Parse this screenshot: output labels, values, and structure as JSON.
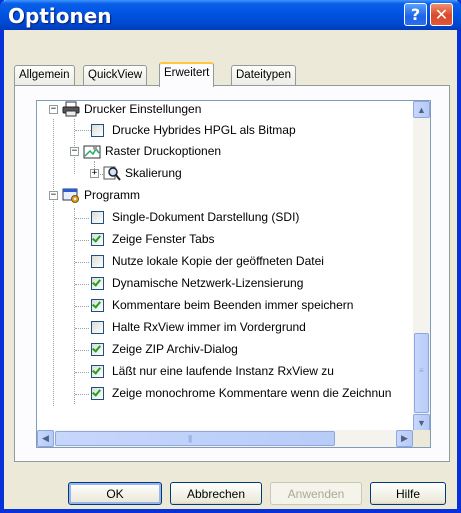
{
  "window": {
    "title": "Optionen",
    "help_glyph": "?",
    "close_glyph": "✕"
  },
  "tabs": [
    {
      "label": "Allgemein"
    },
    {
      "label": "QuickView"
    },
    {
      "label": "Erweitert",
      "selected": true
    },
    {
      "label": "Dateitypen"
    }
  ],
  "tree": {
    "printer_group": {
      "label": "Drucker Einstellungen",
      "icon": "printer-icon",
      "expanded": true
    },
    "hpgl": {
      "label": "Drucke Hybrides HPGL als Bitmap",
      "checked": false
    },
    "raster_group": {
      "label": "Raster Druckoptionen",
      "icon": "raster-icon",
      "expanded": true
    },
    "scaling": {
      "label": "Skalierung",
      "icon": "magnifier-icon",
      "expanded": false
    },
    "program_group": {
      "label": "Programm",
      "icon": "program-icon",
      "expanded": true
    },
    "options": [
      {
        "label": "Single-Dokument Darstellung (SDI)",
        "checked": false
      },
      {
        "label": "Zeige Fenster Tabs",
        "checked": true
      },
      {
        "label": "Nutze lokale Kopie der geöffneten Datei",
        "checked": false
      },
      {
        "label": "Dynamische Netzwerk-Lizensierung",
        "checked": true
      },
      {
        "label": "Kommentare beim Beenden immer speichern",
        "checked": true
      },
      {
        "label": "Halte RxView immer im Vordergrund",
        "checked": false
      },
      {
        "label": "Zeige ZIP Archiv-Dialog",
        "checked": true
      },
      {
        "label": "Läßt nur eine laufende Instanz RxView zu",
        "checked": true
      },
      {
        "label": "Zeige monochrome Kommentare wenn die Zeichnun",
        "checked": true
      }
    ]
  },
  "scrollbars": {
    "up": "▲",
    "down": "▼",
    "left": "◀",
    "right": "▶",
    "grip": "≡",
    "hgrip": "|||"
  },
  "buttons": {
    "ok": "OK",
    "cancel": "Abbrechen",
    "apply": "Anwenden",
    "help": "Hilfe"
  },
  "colors": {
    "title_bar": "#0054e3",
    "active_tab_accent": "#ffc83c",
    "check": "#21a121"
  }
}
